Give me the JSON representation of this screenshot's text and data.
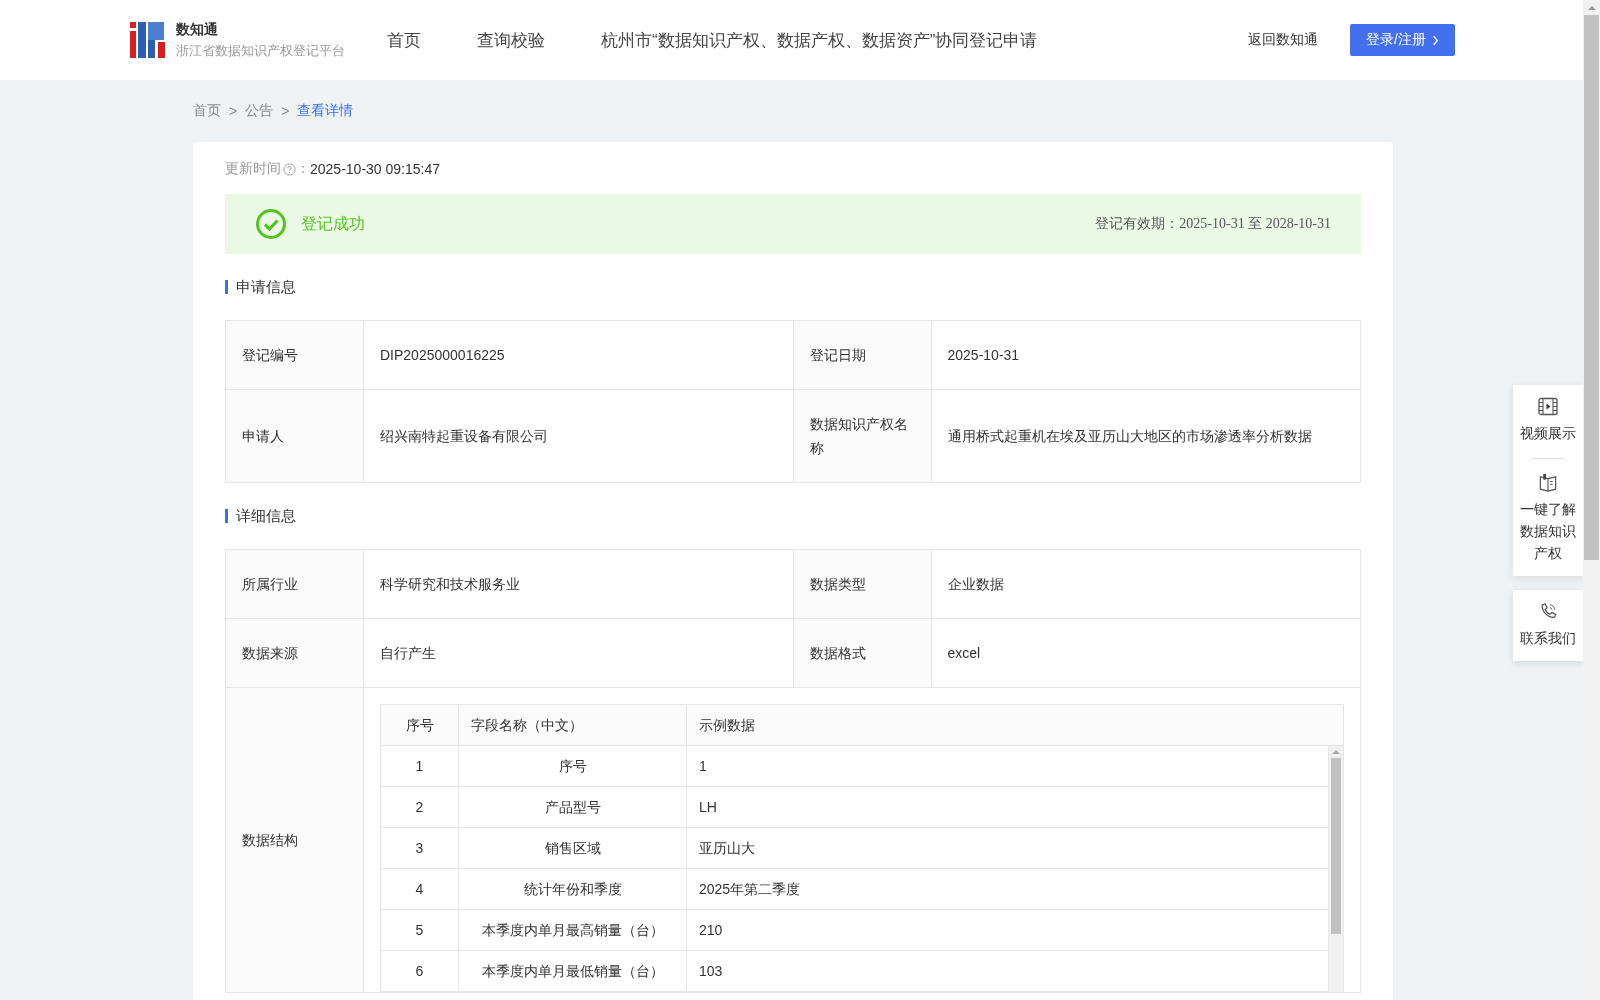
{
  "header": {
    "logo_title": "数知通",
    "logo_subtitle": "浙江省数据知识产权登记平台",
    "nav": [
      {
        "label": "首页"
      },
      {
        "label": "查询校验"
      },
      {
        "label": "杭州市“数据知识产权、数据产权、数据资产”协同登记申请"
      }
    ],
    "return_link": "返回数知通",
    "login_button": "登录/注册"
  },
  "breadcrumb": [
    {
      "label": "首页",
      "current": false
    },
    {
      "label": "公告",
      "current": false
    },
    {
      "label": "查看详情",
      "current": true
    }
  ],
  "breadcrumb_separator": ">",
  "update": {
    "label": "更新时间",
    "colon": "：",
    "value": "2025-10-30 09:15:47"
  },
  "status": {
    "text": "登记成功",
    "validity": "登记有效期：2025-10-31 至 2028-10-31"
  },
  "sections": [
    {
      "title": "申请信息",
      "rows": [
        [
          {
            "label": "登记编号",
            "value": "DIP2025000016225"
          },
          {
            "label": "登记日期",
            "value": "2025-10-31"
          }
        ],
        [
          {
            "label": "申请人",
            "value": "绍兴南特起重设备有限公司"
          },
          {
            "label": "数据知识产权名称",
            "value": "通用桥式起重机在埃及亚历山大地区的市场渗透率分析数据"
          }
        ]
      ]
    },
    {
      "title": "详细信息",
      "rows": [
        [
          {
            "label": "所属行业",
            "value": "科学研究和技术服务业"
          },
          {
            "label": "数据类型",
            "value": "企业数据"
          }
        ],
        [
          {
            "label": "数据来源",
            "value": "自行产生"
          },
          {
            "label": "数据格式",
            "value": "excel"
          }
        ]
      ],
      "structure": {
        "label": "数据结构",
        "columns": [
          "序号",
          "字段名称（中文）",
          "示例数据"
        ],
        "rows": [
          [
            "1",
            "序号",
            "1"
          ],
          [
            "2",
            "产品型号",
            "LH"
          ],
          [
            "3",
            "销售区域",
            "亚历山大"
          ],
          [
            "4",
            "统计年份和季度",
            "2025年第二季度"
          ],
          [
            "5",
            "本季度内单月最高销量（台）",
            "210"
          ],
          [
            "6",
            "本季度内单月最低销量（台）",
            "103"
          ]
        ]
      }
    }
  ],
  "float_panel": [
    {
      "label": "视频展示"
    },
    {
      "label": "一键了解数据知识产权"
    },
    {
      "label": "联系我们"
    }
  ]
}
